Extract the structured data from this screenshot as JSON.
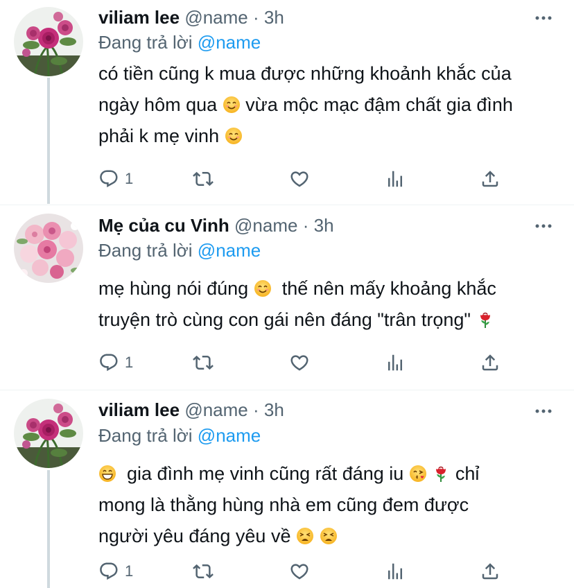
{
  "tweets": [
    {
      "display_name": "viliam lee",
      "handle": "@name",
      "time_sep": "·",
      "time": "3h",
      "replying_prefix": "Đang trả lời",
      "replying_to": "@name",
      "text_lines": [
        "có tiền cũng k mua được những khoảnh khắc của",
        "ngày hôm qua",
        " vừa mộc mạc đậm chất gia đình",
        "phải k mẹ vinh"
      ],
      "reply_count": "1",
      "avatar": "rose-avatar-icon"
    },
    {
      "display_name": "Mẹ của cu Vinh",
      "handle": "@name",
      "time_sep": "·",
      "time": "3h",
      "replying_prefix": "Đang trả lời",
      "replying_to": "@name",
      "text_lines": [
        "mẹ hùng nói đúng",
        "  thế nên mấy khoảng khắc",
        "truyện trò cùng con gái nên đáng \"trân trọng\""
      ],
      "reply_count": "1",
      "avatar": "flower-bouquet-avatar-icon"
    },
    {
      "display_name": "viliam lee",
      "handle": "@name",
      "time_sep": "·",
      "time": "3h",
      "replying_prefix": "Đang trả lời",
      "replying_to": "@name",
      "text_lines": [
        "  gia đình mẹ vinh cũng rất đáng iu",
        "chỉ",
        "mong là thằng hùng nhà em cũng đem được",
        "người yêu đáng yêu về"
      ],
      "reply_count": "1",
      "avatar": "rose-avatar-icon"
    }
  ],
  "icons": {
    "reply": "reply-icon",
    "retweet": "retweet-icon",
    "like": "heart-icon",
    "views": "analytics-icon",
    "share": "share-icon",
    "more": "more-options-icon"
  },
  "colors": {
    "text": "#0f1419",
    "secondary": "#536471",
    "link": "#1d9bf0",
    "thread_line": "#cfd9de"
  }
}
